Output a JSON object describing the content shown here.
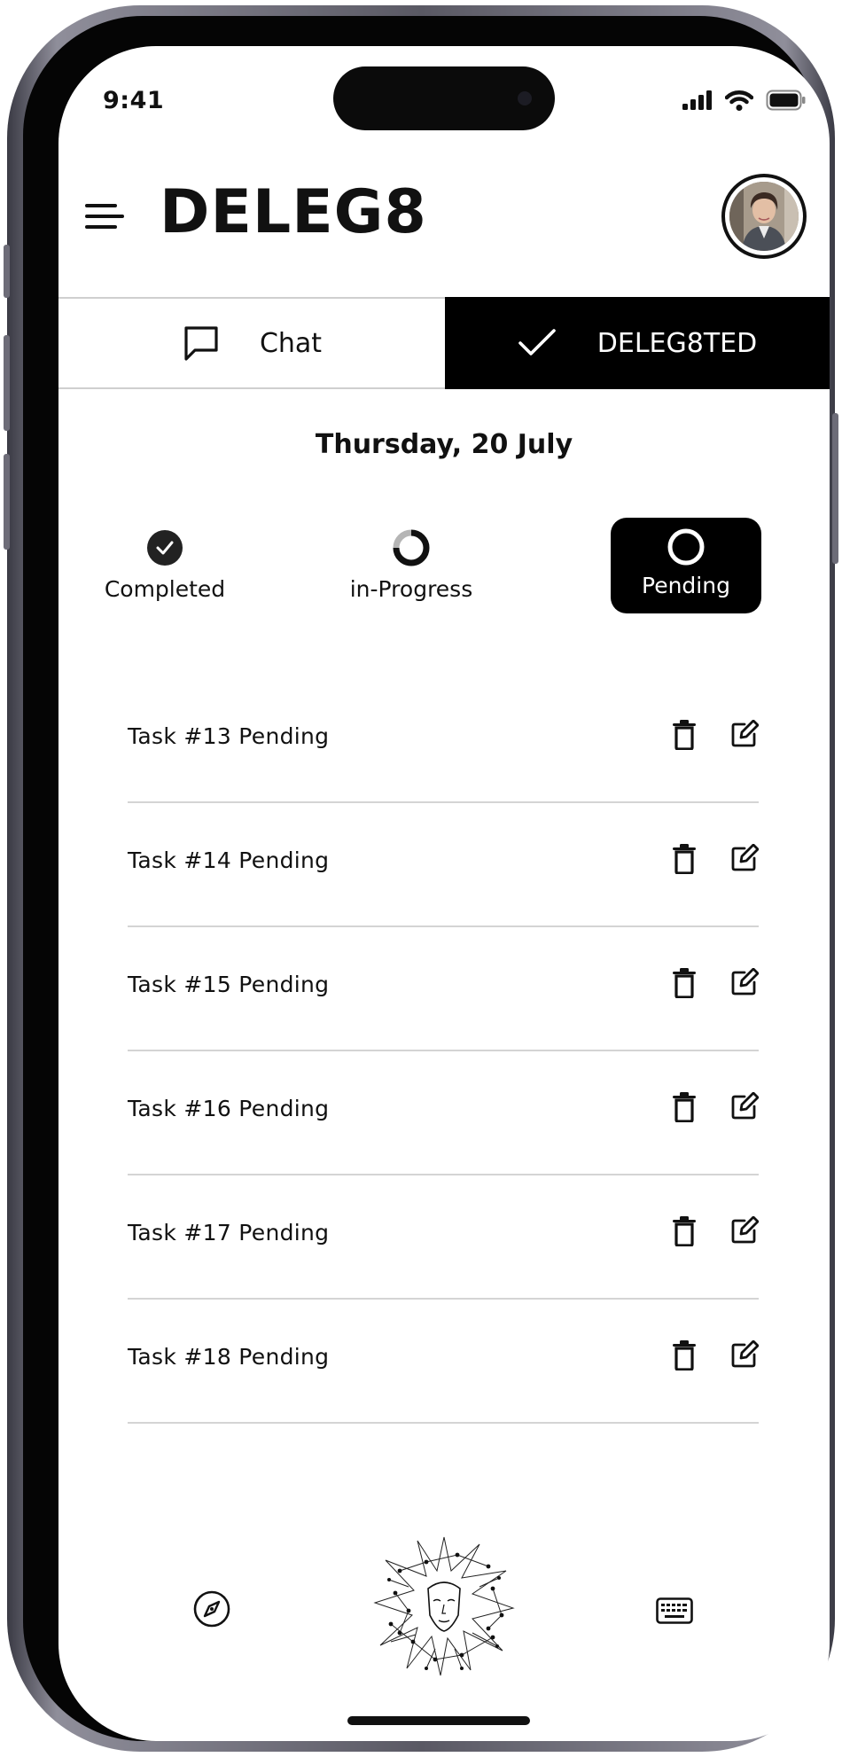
{
  "status_bar": {
    "time": "9:41"
  },
  "header": {
    "title": "DELEG8",
    "menu_icon": "hamburger-menu-icon",
    "avatar": "user-avatar"
  },
  "tabs": [
    {
      "label": "Chat",
      "icon": "chat-bubble-icon",
      "active": false
    },
    {
      "label": "DELEG8TED",
      "icon": "checkmark-icon",
      "active": true
    }
  ],
  "date_heading": "Thursday, 20 July",
  "filters": [
    {
      "label": "Completed",
      "icon": "check-circle-icon",
      "active": false
    },
    {
      "label": "in-Progress",
      "icon": "progress-ring-icon",
      "active": false
    },
    {
      "label": "Pending",
      "icon": "empty-circle-icon",
      "active": true
    }
  ],
  "tasks": [
    {
      "label": "Task #13 Pending"
    },
    {
      "label": "Task #14 Pending"
    },
    {
      "label": "Task #15 Pending"
    },
    {
      "label": "Task #16 Pending"
    },
    {
      "label": "Task #17 Pending"
    },
    {
      "label": "Task #18 Pending"
    }
  ],
  "task_actions": {
    "delete_icon": "trash-icon",
    "edit_icon": "edit-icon"
  },
  "bottom_nav": {
    "left_icon": "compass-icon",
    "center_icon": "ai-face-logo-icon",
    "right_icon": "keyboard-icon"
  },
  "colors": {
    "accent": "#000000",
    "background": "#ffffff",
    "divider": "#d4d4d4",
    "text": "#111111"
  }
}
